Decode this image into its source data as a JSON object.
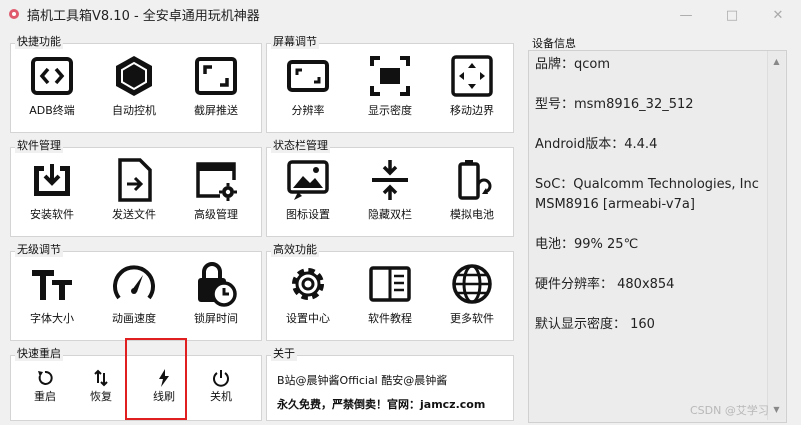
{
  "window": {
    "title": "搞机工具箱V8.10 - 全安卓通用玩机神器",
    "app_icon": "gear-icon",
    "controls": [
      "minimize-icon",
      "maximize-icon",
      "close-icon"
    ]
  },
  "groups": {
    "quick": {
      "title": "快捷功能",
      "items": [
        {
          "label": "ADB终端",
          "icon": "terminal-code-icon"
        },
        {
          "label": "自动控机",
          "icon": "hexagon-icon"
        },
        {
          "label": "截屏推送",
          "icon": "screenshot-frame-icon"
        }
      ]
    },
    "screen": {
      "title": "屏幕调节",
      "items": [
        {
          "label": "分辨率",
          "icon": "resolution-icon"
        },
        {
          "label": "显示密度",
          "icon": "density-icon"
        },
        {
          "label": "移动边界",
          "icon": "move-bounds-icon"
        }
      ]
    },
    "software": {
      "title": "软件管理",
      "items": [
        {
          "label": "安装软件",
          "icon": "install-tray-icon"
        },
        {
          "label": "发送文件",
          "icon": "send-file-icon"
        },
        {
          "label": "高级管理",
          "icon": "window-gear-icon"
        }
      ]
    },
    "statusbar": {
      "title": "状态栏管理",
      "items": [
        {
          "label": "图标设置",
          "icon": "image-icon"
        },
        {
          "label": "隐藏双栏",
          "icon": "collapse-bars-icon"
        },
        {
          "label": "模拟电池",
          "icon": "battery-refresh-icon"
        }
      ]
    },
    "accessibility": {
      "title": "无级调节",
      "items": [
        {
          "label": "字体大小",
          "icon": "font-size-icon"
        },
        {
          "label": "动画速度",
          "icon": "speedometer-icon"
        },
        {
          "label": "锁屏时间",
          "icon": "lock-clock-icon"
        }
      ]
    },
    "efficient": {
      "title": "高效功能",
      "items": [
        {
          "label": "设置中心",
          "icon": "settings-gear-icon"
        },
        {
          "label": "软件教程",
          "icon": "book-icon"
        },
        {
          "label": "更多软件",
          "icon": "globe-icon"
        }
      ]
    },
    "reboot": {
      "title": "快速重启",
      "items": [
        {
          "label": "重启",
          "icon": "restart-icon"
        },
        {
          "label": "恢复",
          "icon": "recovery-arrows-icon"
        },
        {
          "label": "线刷",
          "icon": "lightning-icon"
        },
        {
          "label": "关机",
          "icon": "power-icon"
        }
      ]
    },
    "about": {
      "title": "关于",
      "line1": "B站@晨钟酱Official   酷安@晨钟酱",
      "line2": "永久免费，严禁倒卖！官网：jamcz.com"
    }
  },
  "device_info": {
    "title": "设备信息",
    "lines": [
      "品牌：qcom",
      "型号：msm8916_32_512",
      "Android版本：4.4.4",
      "SoC：Qualcomm Technologies, Inc MSM8916 [armeabi-v7a]",
      "电池：99%  25℃",
      "硬件分辨率：  480x854",
      "默认显示密度：  160"
    ]
  },
  "watermark": "CSDN @艾学习",
  "colors": {
    "highlight": "#e02020",
    "panel": "#ffffff",
    "info_bg": "#ececec"
  }
}
